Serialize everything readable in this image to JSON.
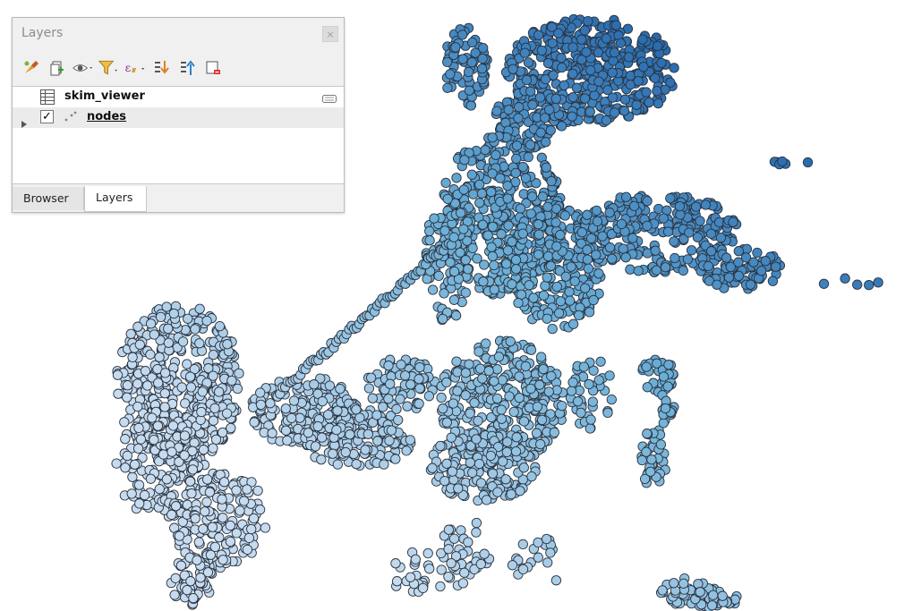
{
  "panel": {
    "title": "Layers",
    "close_glyph": "×",
    "toolbar_icons": [
      "style-manager-icon",
      "add-group-icon",
      "visibility-eye-icon",
      "filter-icon",
      "expression-filter-icon",
      "expand-all-icon",
      "collapse-all-icon",
      "remove-layer-icon"
    ],
    "layers": [
      {
        "name": "skim_viewer",
        "type": "table",
        "checked": null
      },
      {
        "name": "nodes",
        "type": "point",
        "checked": true
      }
    ],
    "check_glyph": "✓",
    "tabs": [
      "Browser",
      "Layers"
    ],
    "active_tab": "Layers"
  },
  "map": {
    "point_color_light": "#c6dbef",
    "point_color_mid": "#6baed6",
    "point_color_dark": "#1b5da8",
    "outline_color": "#2b3440"
  }
}
